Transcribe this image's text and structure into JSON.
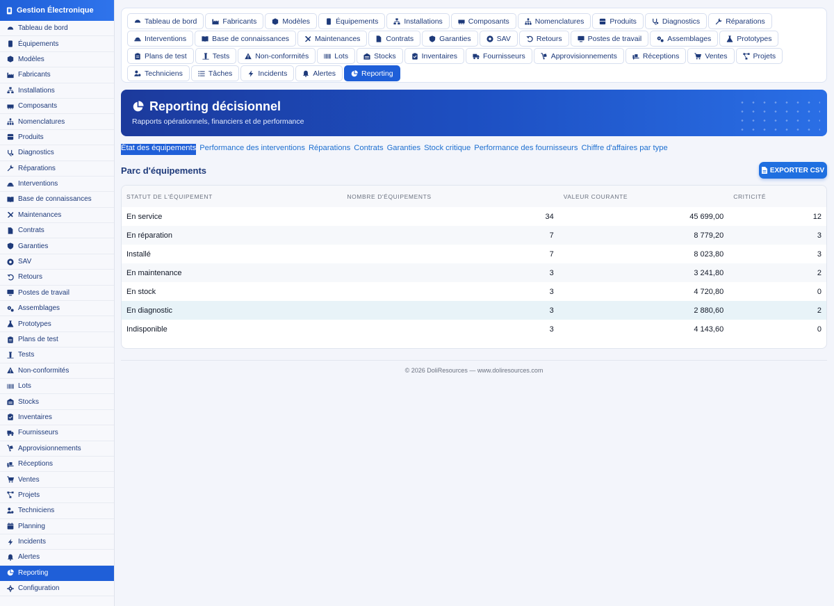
{
  "app": {
    "title": "Gestion Électronique"
  },
  "sidebar": {
    "items": [
      {
        "label": "Tableau de bord",
        "icon": "dashboard-icon"
      },
      {
        "label": "Équipements",
        "icon": "device-icon"
      },
      {
        "label": "Modèles",
        "icon": "cube-icon"
      },
      {
        "label": "Fabricants",
        "icon": "factory-icon"
      },
      {
        "label": "Installations",
        "icon": "network-icon"
      },
      {
        "label": "Composants",
        "icon": "memory-icon"
      },
      {
        "label": "Nomenclatures",
        "icon": "hierarchy-icon"
      },
      {
        "label": "Produits",
        "icon": "box-icon"
      },
      {
        "label": "Diagnostics",
        "icon": "stethoscope-icon"
      },
      {
        "label": "Réparations",
        "icon": "wrench-icon"
      },
      {
        "label": "Interventions",
        "icon": "hardhat-icon"
      },
      {
        "label": "Base de connaissances",
        "icon": "book-icon"
      },
      {
        "label": "Maintenances",
        "icon": "tools-icon"
      },
      {
        "label": "Contrats",
        "icon": "file-icon"
      },
      {
        "label": "Garanties",
        "icon": "shield-icon"
      },
      {
        "label": "SAV",
        "icon": "support-icon"
      },
      {
        "label": "Retours",
        "icon": "undo-icon"
      },
      {
        "label": "Postes de travail",
        "icon": "desktop-icon"
      },
      {
        "label": "Assemblages",
        "icon": "gears-icon"
      },
      {
        "label": "Prototypes",
        "icon": "flask-icon"
      },
      {
        "label": "Plans de test",
        "icon": "clipboard-icon"
      },
      {
        "label": "Tests",
        "icon": "vial-icon"
      },
      {
        "label": "Non-conformités",
        "icon": "warning-icon"
      },
      {
        "label": "Lots",
        "icon": "barcode-icon"
      },
      {
        "label": "Stocks",
        "icon": "warehouse-icon"
      },
      {
        "label": "Inventaires",
        "icon": "clipboard-check-icon"
      },
      {
        "label": "Fournisseurs",
        "icon": "truck-icon"
      },
      {
        "label": "Approvisionnements",
        "icon": "dolly-icon"
      },
      {
        "label": "Réceptions",
        "icon": "truck-loading-icon"
      },
      {
        "label": "Ventes",
        "icon": "cart-icon"
      },
      {
        "label": "Projets",
        "icon": "project-diagram-icon"
      },
      {
        "label": "Techniciens",
        "icon": "users-gear-icon"
      },
      {
        "label": "Planning",
        "icon": "calendar-icon"
      },
      {
        "label": "Incidents",
        "icon": "bolt-icon"
      },
      {
        "label": "Alertes",
        "icon": "bell-icon"
      },
      {
        "label": "Reporting",
        "icon": "chart-pie-icon",
        "active": true
      },
      {
        "label": "Configuration",
        "icon": "gear-icon"
      }
    ]
  },
  "tabs": [
    {
      "label": "Tableau de bord",
      "icon": "dashboard-icon"
    },
    {
      "label": "Fabricants",
      "icon": "factory-icon"
    },
    {
      "label": "Modèles",
      "icon": "cube-icon"
    },
    {
      "label": "Équipements",
      "icon": "device-icon"
    },
    {
      "label": "Installations",
      "icon": "network-icon"
    },
    {
      "label": "Composants",
      "icon": "memory-icon"
    },
    {
      "label": "Nomenclatures",
      "icon": "hierarchy-icon"
    },
    {
      "label": "Produits",
      "icon": "box-icon"
    },
    {
      "label": "Diagnostics",
      "icon": "stethoscope-icon"
    },
    {
      "label": "Réparations",
      "icon": "wrench-icon"
    },
    {
      "label": "Interventions",
      "icon": "hardhat-icon"
    },
    {
      "label": "Base de connaissances",
      "icon": "book-icon"
    },
    {
      "label": "Maintenances",
      "icon": "tools-icon"
    },
    {
      "label": "Contrats",
      "icon": "file-icon"
    },
    {
      "label": "Garanties",
      "icon": "shield-icon"
    },
    {
      "label": "SAV",
      "icon": "support-icon"
    },
    {
      "label": "Retours",
      "icon": "undo-icon"
    },
    {
      "label": "Postes de travail",
      "icon": "desktop-icon"
    },
    {
      "label": "Assemblages",
      "icon": "gears-icon"
    },
    {
      "label": "Prototypes",
      "icon": "flask-icon"
    },
    {
      "label": "Plans de test",
      "icon": "clipboard-icon"
    },
    {
      "label": "Tests",
      "icon": "vial-icon"
    },
    {
      "label": "Non-conformités",
      "icon": "warning-icon"
    },
    {
      "label": "Lots",
      "icon": "barcode-icon"
    },
    {
      "label": "Stocks",
      "icon": "warehouse-icon"
    },
    {
      "label": "Inventaires",
      "icon": "clipboard-check-icon"
    },
    {
      "label": "Fournisseurs",
      "icon": "truck-icon"
    },
    {
      "label": "Approvisionnements",
      "icon": "dolly-icon"
    },
    {
      "label": "Réceptions",
      "icon": "truck-loading-icon"
    },
    {
      "label": "Ventes",
      "icon": "cart-icon"
    },
    {
      "label": "Projets",
      "icon": "project-diagram-icon"
    },
    {
      "label": "Techniciens",
      "icon": "users-gear-icon"
    },
    {
      "label": "Tâches",
      "icon": "list-icon"
    },
    {
      "label": "Incidents",
      "icon": "bolt-icon"
    },
    {
      "label": "Alertes",
      "icon": "bell-icon"
    },
    {
      "label": "Reporting",
      "icon": "chart-pie-icon",
      "active": true
    }
  ],
  "hero": {
    "title": "Reporting décisionnel",
    "subtitle": "Rapports opérationnels, financiers et de performance"
  },
  "report_nav": [
    {
      "label": "État des équipements",
      "selected": true
    },
    {
      "label": "Performance des interventions"
    },
    {
      "label": "Réparations"
    },
    {
      "label": "Contrats"
    },
    {
      "label": "Garanties"
    },
    {
      "label": "Stock critique"
    },
    {
      "label": "Performance des fournisseurs"
    },
    {
      "label": "Chiffre d'affaires par type"
    }
  ],
  "section": {
    "title": "Parc d'équipements",
    "export_label": "EXPORTER CSV"
  },
  "table": {
    "headers": [
      "STATUT DE L'ÉQUIPEMENT",
      "NOMBRE D'ÉQUIPEMENTS",
      "VALEUR COURANTE",
      "CRITICITÉ"
    ],
    "rows": [
      {
        "status": "En service",
        "count": "34",
        "value": "45 699,00",
        "criticality": "12"
      },
      {
        "status": "En réparation",
        "count": "7",
        "value": "8 779,20",
        "criticality": "3"
      },
      {
        "status": "Installé",
        "count": "7",
        "value": "8 023,80",
        "criticality": "3"
      },
      {
        "status": "En maintenance",
        "count": "3",
        "value": "3 241,80",
        "criticality": "2"
      },
      {
        "status": "En stock",
        "count": "3",
        "value": "4 720,80",
        "criticality": "0"
      },
      {
        "status": "En diagnostic",
        "count": "3",
        "value": "2 880,60",
        "criticality": "2",
        "highlight": true
      },
      {
        "status": "Indisponible",
        "count": "3",
        "value": "4 143,60",
        "criticality": "0"
      }
    ]
  },
  "footer": {
    "text": "© 2026 DoliResources — www.doliresources.com"
  }
}
